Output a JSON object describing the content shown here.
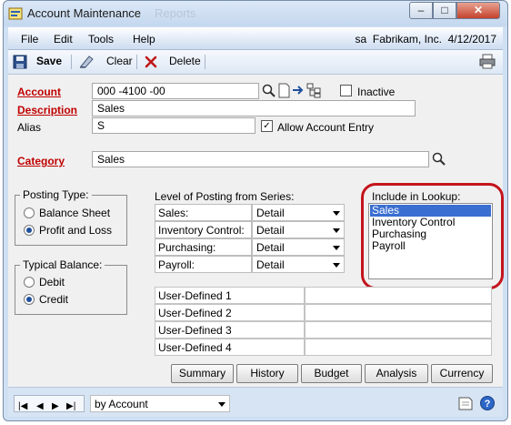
{
  "window": {
    "title": "Account Maintenance",
    "ghost_title": "Reports",
    "min_label": "–",
    "max_label": "□",
    "close_label": "✕"
  },
  "menu": {
    "items": [
      "File",
      "Edit",
      "Tools",
      "Help"
    ],
    "user": "sa",
    "company": "Fabrikam, Inc.",
    "date": "4/12/2017"
  },
  "toolbar": {
    "save": "Save",
    "clear": "Clear",
    "delete": "Delete"
  },
  "form": {
    "account_label": "Account",
    "account_value": "000 -4100 -00",
    "inactive_label": "Inactive",
    "inactive_checked": false,
    "description_label": "Description",
    "description_value": "Sales",
    "alias_label": "Alias",
    "alias_value": "S",
    "allow_entry_label": "Allow Account Entry",
    "allow_entry_checked": true,
    "category_label": "Category",
    "category_value": "Sales"
  },
  "posting_type": {
    "title": "Posting Type:",
    "options": [
      "Balance Sheet",
      "Profit and Loss"
    ],
    "selected": "Profit and Loss"
  },
  "typical_balance": {
    "title": "Typical Balance:",
    "options": [
      "Debit",
      "Credit"
    ],
    "selected": "Credit"
  },
  "posting_series": {
    "title": "Level of Posting from Series:",
    "rows": [
      {
        "label": "Sales:",
        "value": "Detail"
      },
      {
        "label": "Inventory Control:",
        "value": "Detail"
      },
      {
        "label": "Purchasing:",
        "value": "Detail"
      },
      {
        "label": "Payroll:",
        "value": "Detail"
      }
    ]
  },
  "lookup": {
    "title": "Include in Lookup:",
    "items": [
      "Sales",
      "Inventory Control",
      "Purchasing",
      "Payroll"
    ],
    "selected": "Sales",
    "highlight_color": "#c4141b"
  },
  "user_defined": {
    "labels": [
      "User-Defined 1",
      "User-Defined 2",
      "User-Defined 3",
      "User-Defined 4"
    ],
    "values": [
      "",
      "",
      "",
      ""
    ]
  },
  "buttons": [
    "Summary",
    "History",
    "Budget",
    "Analysis",
    "Currency"
  ],
  "statusbar": {
    "sort_by": "by Account"
  },
  "colors": {
    "required_label": "#c00000",
    "selection": "#3a6ed0",
    "accent": "#1f4f9c"
  }
}
